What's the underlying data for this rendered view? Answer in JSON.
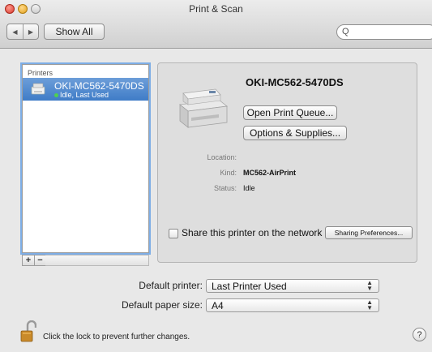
{
  "window": {
    "title": "Print & Scan",
    "back_glyph": "◀",
    "forward_glyph": "▶",
    "show_all_label": "Show All",
    "search_placeholder": "",
    "search_glyph": "Q"
  },
  "printers": {
    "header": "Printers",
    "items": [
      {
        "name": "OKI-MC562-5470DS",
        "status": "Idle, Last Used",
        "selected": true
      }
    ],
    "add_label": "+",
    "remove_label": "−"
  },
  "detail": {
    "printer_name": "OKI-MC562-5470DS",
    "open_queue_label": "Open Print Queue...",
    "options_label": "Options & Supplies...",
    "location_label": "Location:",
    "location_value": "",
    "kind_label": "Kind:",
    "kind_value": "MC562-AirPrint",
    "status_label": "Status:",
    "status_value": "Idle",
    "share_label": "Share this printer on the network",
    "share_checked": false,
    "sharing_prefs_label": "Sharing Preferences..."
  },
  "defaults": {
    "printer_label": "Default printer:",
    "printer_value": "Last Printer Used",
    "paper_label": "Default paper size:",
    "paper_value": "A4"
  },
  "footer": {
    "lock_text": "Click the lock to prevent further changes.",
    "help_glyph": "?"
  },
  "colors": {
    "selection": "#3f7cc7",
    "focus_ring": "#7eaee6",
    "status_dot": "#4fd04f",
    "close": "#d8382c",
    "minimize": "#e3a21c"
  }
}
